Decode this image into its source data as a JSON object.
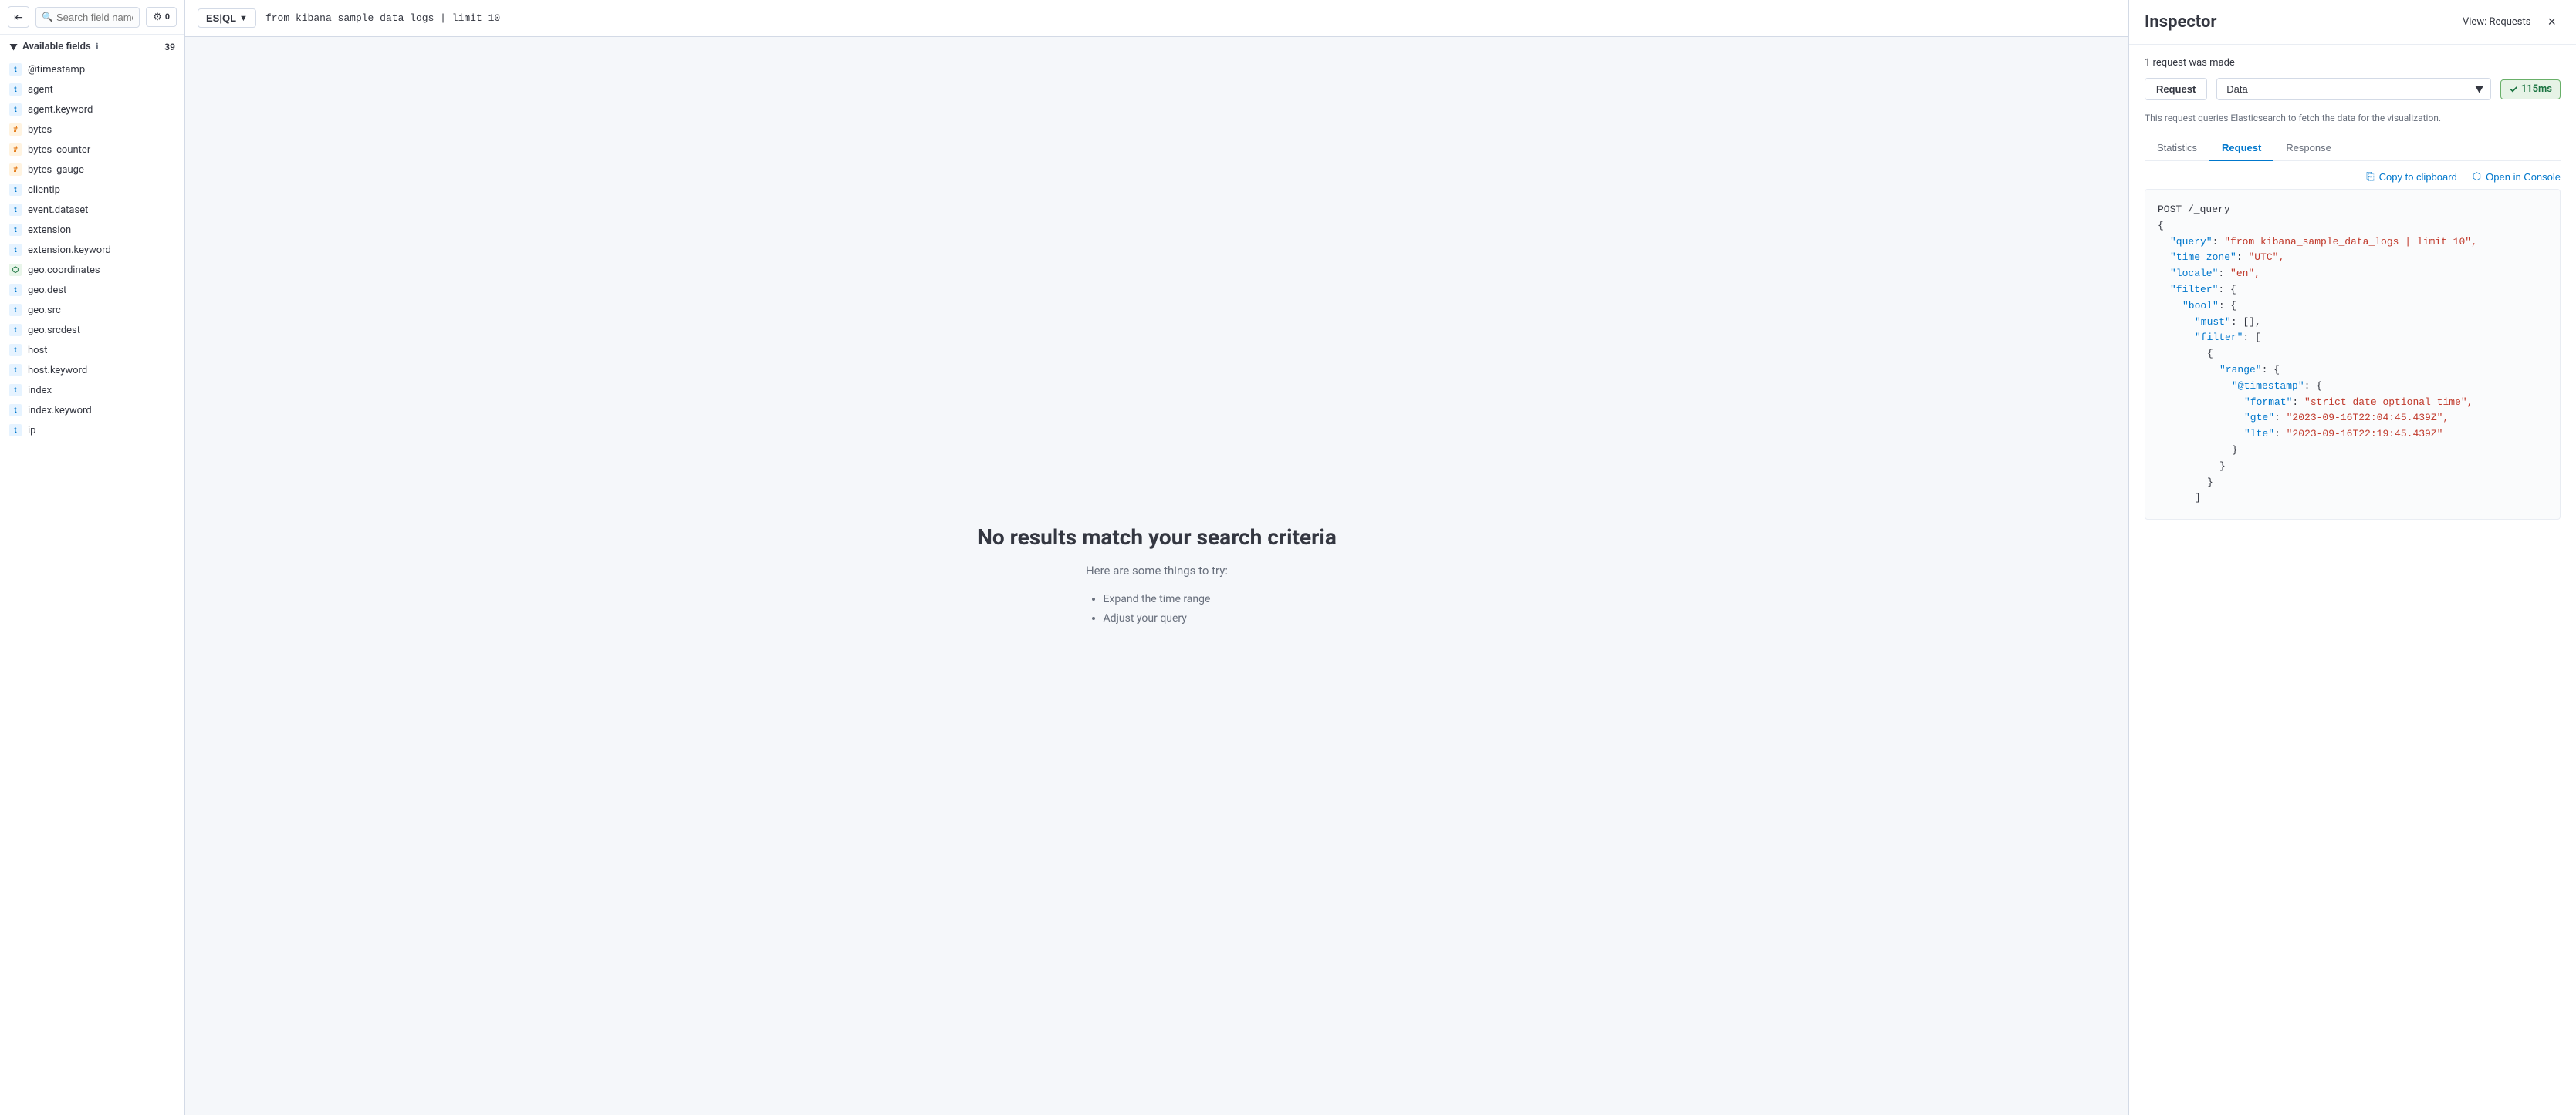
{
  "sidebar": {
    "search_placeholder": "Search field names",
    "filter_count": "0",
    "available_fields_label": "Available fields",
    "fields_count": "39",
    "fields": [
      {
        "name": "@timestamp",
        "type": "t"
      },
      {
        "name": "agent",
        "type": "t"
      },
      {
        "name": "agent.keyword",
        "type": "t"
      },
      {
        "name": "bytes",
        "type": "hash"
      },
      {
        "name": "bytes_counter",
        "type": "hash"
      },
      {
        "name": "bytes_gauge",
        "type": "hash"
      },
      {
        "name": "clientip",
        "type": "t"
      },
      {
        "name": "event.dataset",
        "type": "t"
      },
      {
        "name": "extension",
        "type": "t"
      },
      {
        "name": "extension.keyword",
        "type": "t"
      },
      {
        "name": "geo.coordinates",
        "type": "geo"
      },
      {
        "name": "geo.dest",
        "type": "t"
      },
      {
        "name": "geo.src",
        "type": "t"
      },
      {
        "name": "geo.srcdest",
        "type": "t"
      },
      {
        "name": "host",
        "type": "t"
      },
      {
        "name": "host.keyword",
        "type": "t"
      },
      {
        "name": "index",
        "type": "t"
      },
      {
        "name": "index.keyword",
        "type": "t"
      },
      {
        "name": "ip",
        "type": "t"
      }
    ]
  },
  "query_bar": {
    "badge_text": "ES|QL",
    "query_text": "from kibana_sample_data_logs | limit 10"
  },
  "main": {
    "no_results_title": "No results match your search criteria",
    "no_results_subtitle": "Here are some things to try:",
    "suggestions": [
      "Expand the time range",
      "Adjust your query"
    ]
  },
  "inspector": {
    "title": "Inspector",
    "view_requests_label": "View: Requests",
    "close_icon": "×",
    "request_info": "1 request was made",
    "request_label": "Request",
    "data_option": "Data",
    "timing": "115ms",
    "description": "This request queries Elasticsearch to fetch the data for the visualization.",
    "tabs": [
      {
        "id": "statistics",
        "label": "Statistics"
      },
      {
        "id": "request",
        "label": "Request"
      },
      {
        "id": "response",
        "label": "Response"
      }
    ],
    "active_tab": "request",
    "copy_label": "Copy to clipboard",
    "open_label": "Open in Console",
    "code_post": "POST /_query",
    "code_lines": [
      {
        "indent": 0,
        "text": "{"
      },
      {
        "indent": 1,
        "key": "\"query\"",
        "sep": ": ",
        "val": "\"from kibana_sample_data_logs | limit 10\"",
        "comma": ","
      },
      {
        "indent": 1,
        "key": "\"time_zone\"",
        "sep": ": ",
        "val": "\"UTC\"",
        "comma": ","
      },
      {
        "indent": 1,
        "key": "\"locale\"",
        "sep": ": ",
        "val": "\"en\"",
        "comma": ","
      },
      {
        "indent": 1,
        "key": "\"filter\"",
        "sep": ": ",
        "val": "{",
        "comma": ""
      },
      {
        "indent": 2,
        "key": "\"bool\"",
        "sep": ": ",
        "val": "{",
        "comma": ""
      },
      {
        "indent": 3,
        "key": "\"must\"",
        "sep": ": ",
        "val": "[]",
        "comma": ","
      },
      {
        "indent": 3,
        "key": "\"filter\"",
        "sep": ": ",
        "val": "[",
        "comma": ""
      },
      {
        "indent": 4,
        "text": "{"
      },
      {
        "indent": 5,
        "key": "\"range\"",
        "sep": ": ",
        "val": "{",
        "comma": ""
      },
      {
        "indent": 6,
        "key": "\"@timestamp\"",
        "sep": ": ",
        "val": "{",
        "comma": ""
      },
      {
        "indent": 7,
        "key": "\"format\"",
        "sep": ": ",
        "val": "\"strict_date_optional_time\"",
        "comma": ","
      },
      {
        "indent": 7,
        "key": "\"gte\"",
        "sep": ": ",
        "val": "\"2023-09-16T22:04:45.439Z\"",
        "comma": ","
      },
      {
        "indent": 7,
        "key": "\"lte\"",
        "sep": ": ",
        "val": "\"2023-09-16T22:19:45.439Z\"",
        "comma": ""
      },
      {
        "indent": 6,
        "text": "}"
      },
      {
        "indent": 5,
        "text": "}"
      },
      {
        "indent": 4,
        "text": "}"
      },
      {
        "indent": 3,
        "text": "]"
      }
    ]
  }
}
